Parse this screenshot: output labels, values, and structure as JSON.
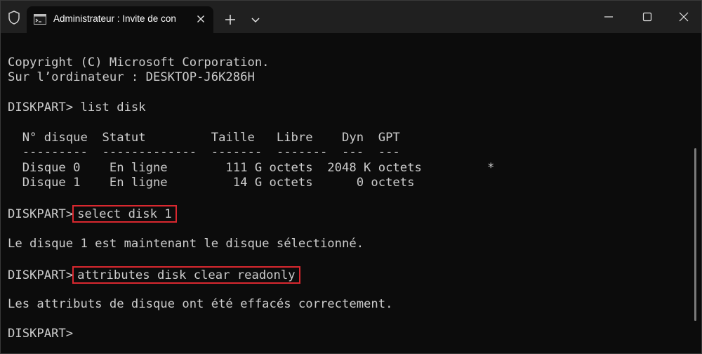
{
  "titlebar": {
    "tab_title": "Administrateur : Invite de con",
    "icons": {
      "shield": "shield-icon",
      "terminal": "terminal-icon",
      "close_tab": "close-icon",
      "new_tab": "plus-icon",
      "dropdown": "chevron-down-icon",
      "minimize": "minimize-icon",
      "maximize": "maximize-icon",
      "close_window": "close-icon"
    }
  },
  "terminal": {
    "line1": "Copyright (C) Microsoft Corporation.",
    "line2": "Sur l’ordinateur : DESKTOP-J6K286H",
    "cmd1_prompt": "DISKPART> ",
    "cmd1": "list disk",
    "table_header": "  N° disque  Statut         Taille   Libre    Dyn  GPT",
    "table_sep": "  ---------  -------------  -------  -------  ---  ---",
    "table_row1": "  Disque 0    En ligne        111 G octets  2048 K octets         *",
    "table_row2": "  Disque 1    En ligne         14 G octets      0 octets",
    "cmd2_prompt": "DISKPART>",
    "cmd2": "select disk 1",
    "out2": "Le disque 1 est maintenant le disque sélectionné.",
    "cmd3_prompt": "DISKPART>",
    "cmd3": "attributes disk clear readonly",
    "out3": "Les attributs de disque ont été effacés correctement.",
    "final_prompt": "DISKPART>"
  },
  "colors": {
    "background": "#0c0c0c",
    "titlebar": "#202020",
    "text": "#cccccc",
    "highlight_border": "#d9282f"
  }
}
